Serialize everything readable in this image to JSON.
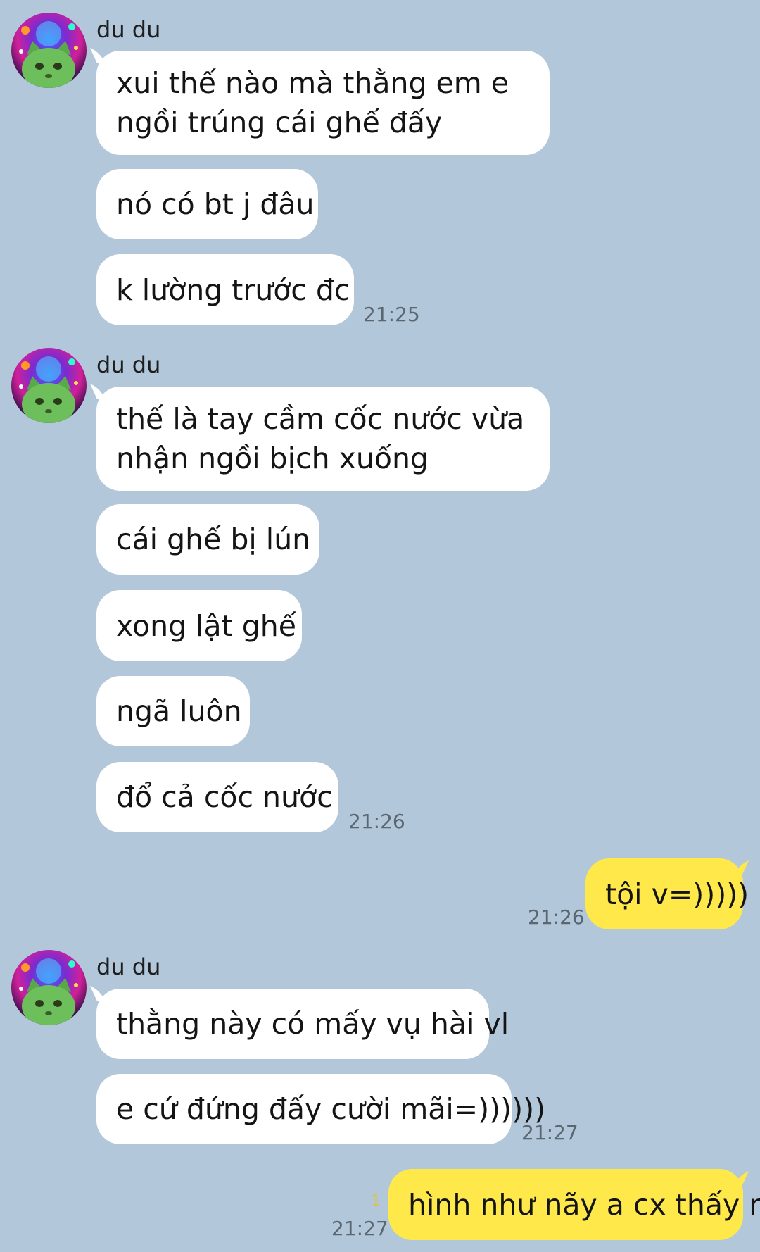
{
  "contact": {
    "name": "du du",
    "avatar_icon": "green-cat-galaxy-avatar"
  },
  "colors": {
    "background": "#b2c7da",
    "incoming_bubble": "#ffffff",
    "outgoing_bubble": "#ffe94a",
    "unread_count": "#e8c21a"
  },
  "groups": [
    {
      "sender": "du du",
      "messages": [
        "xui thế nào mà thằng em e ngồi trúng cái ghế đấy",
        "nó có bt j đâu",
        "k lường trước đc"
      ],
      "time": "21:25"
    },
    {
      "sender": "du du",
      "messages": [
        "thế là tay cầm cốc nước vừa nhận ngồi bịch xuống",
        "cái ghế bị lún",
        "xong lật ghế",
        "ngã luôn",
        "đổ cả cốc nước"
      ],
      "time": "21:26"
    },
    {
      "sender": "me",
      "messages": [
        "tội v=)))))"
      ],
      "time": "21:26"
    },
    {
      "sender": "du du",
      "messages": [
        "thằng này có mấy vụ hài vl",
        "e cứ đứng đấy cười mãi=))))))"
      ],
      "time": "21:27"
    },
    {
      "sender": "me",
      "messages": [
        "hình như nãy a cx thấy r"
      ],
      "time": "21:27",
      "unread": "1"
    }
  ]
}
